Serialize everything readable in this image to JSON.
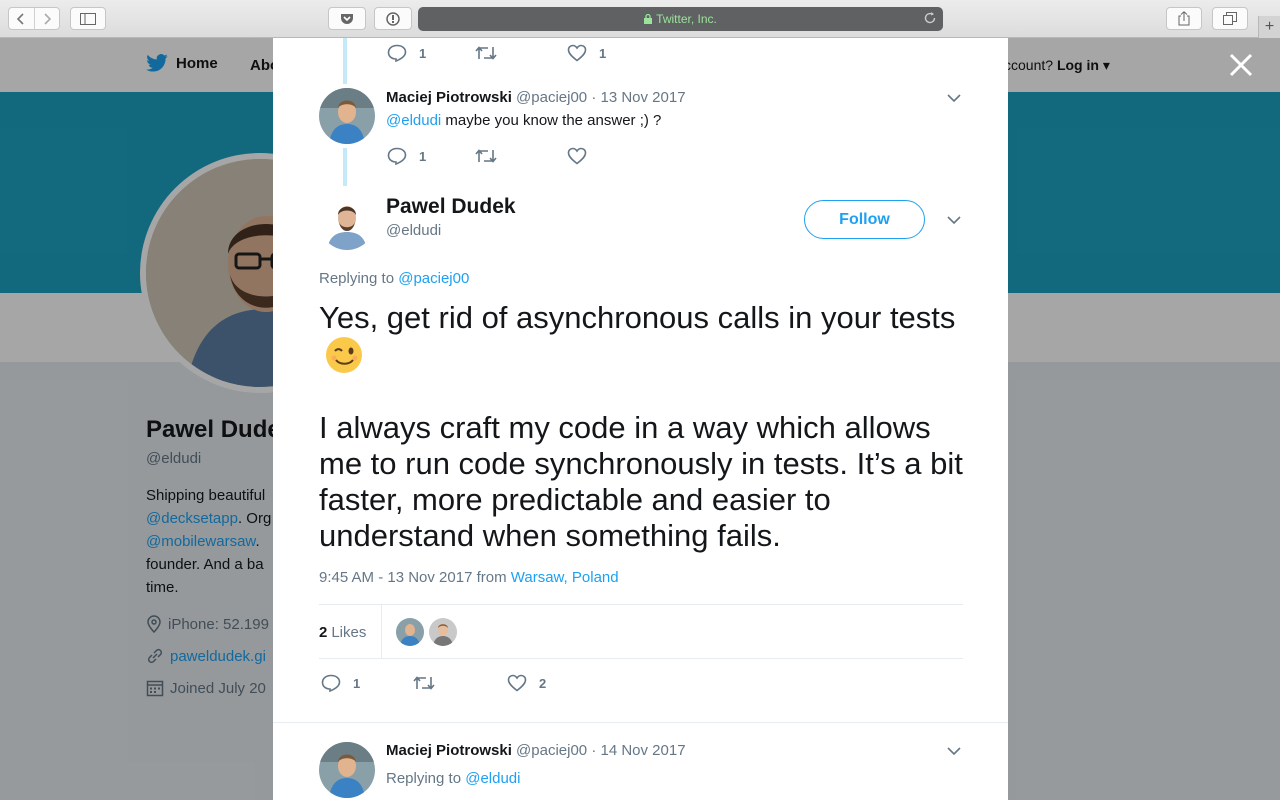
{
  "browser": {
    "url_label": "Twitter, Inc."
  },
  "background_page": {
    "nav": {
      "home": "Home",
      "about_partial": "Abo",
      "account_prompt": "ccount?",
      "login": "Log in"
    },
    "profile": {
      "name": "Pawel Dude",
      "handle": "@eldudi",
      "bio_line1": "Shipping beautiful",
      "bio_link1": "@decksetapp",
      "bio_line2_tail": ". Org",
      "bio_link2": "@mobilewarsaw",
      "bio_link2_tail": ". ",
      "bio_line3": "founder. And a ba",
      "bio_line4": "time.",
      "location": "iPhone: 52.199",
      "website": "paweldudek.gi",
      "joined": "Joined July 20"
    }
  },
  "thread": {
    "prev_actions": {
      "replies": "1",
      "likes": "1"
    },
    "reply1": {
      "name": "Maciej Piotrowski",
      "handle": "@paciej00",
      "date": "· 13 Nov 2017",
      "mention": "@eldudi",
      "text": " maybe you know the answer ;) ?",
      "replies": "1"
    },
    "main": {
      "name": "Pawel Dudek",
      "handle": "@eldudi",
      "follow_label": "Follow",
      "replying_prefix": "Replying to ",
      "replying_to": "@paciej00",
      "paragraph1": "Yes, get rid of asynchronous calls in your tests",
      "paragraph2": "I always craft my code in a way which allows me to run code synchronously in tests. It’s a bit faster, more predictable and easier to understand when something fails.",
      "time": "9:45 AM - 13 Nov 2017 from ",
      "location": "Warsaw, Poland",
      "likes_count": "2",
      "likes_label": "Likes",
      "replies": "1",
      "likes": "2"
    },
    "reply2": {
      "name": "Maciej Piotrowski",
      "handle": "@paciej00",
      "date": "· 14 Nov 2017",
      "replying_prefix": "Replying to ",
      "replying_to": "@eldudi"
    }
  },
  "colors": {
    "accent": "#1da1f2",
    "muted": "#657786",
    "banner": "#1da1c2"
  }
}
